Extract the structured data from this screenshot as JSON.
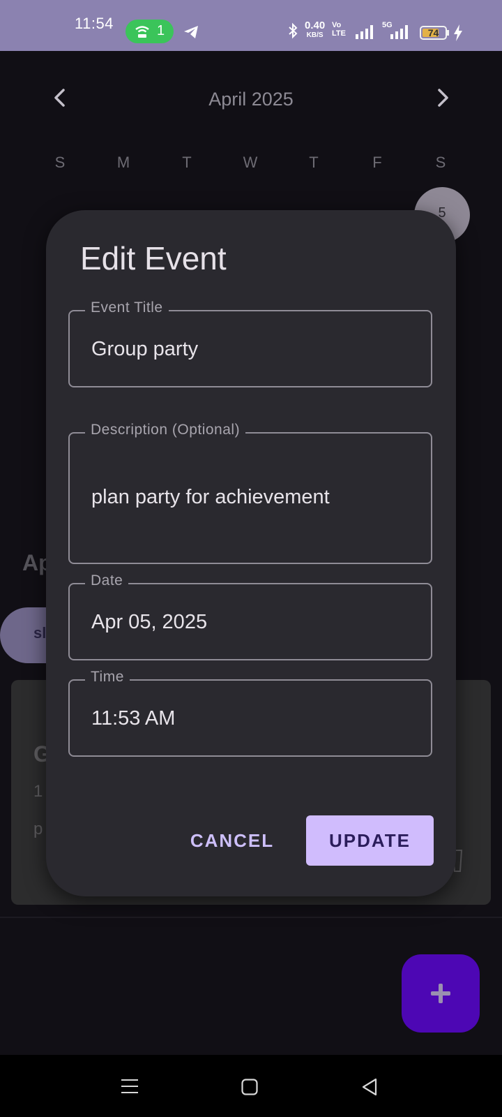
{
  "status_bar": {
    "time": "11:54",
    "hotspot_count": "1",
    "net_speed": "0.40",
    "net_speed_unit": "KB/S",
    "volte_label": "Vo LTE",
    "network_type": "5G",
    "battery": "74",
    "battery_level": 0.74
  },
  "calendar": {
    "month_title": "April 2025",
    "weekdays": [
      "S",
      "M",
      "T",
      "W",
      "T",
      "F",
      "S"
    ],
    "selected_day": "5"
  },
  "background": {
    "section_heading": "Ap",
    "chip_label": "sl",
    "card": {
      "title": "G",
      "time": "1",
      "description": "p"
    }
  },
  "dialog": {
    "title": "Edit Event",
    "fields": [
      {
        "label": "Event Title",
        "value": "Group party"
      },
      {
        "label": "Description (Optional)",
        "value": "plan party for achievement"
      },
      {
        "label": "Date",
        "value": "Apr 05, 2025"
      },
      {
        "label": "Time",
        "value": "11:53 AM"
      }
    ],
    "cancel_label": "CANCEL",
    "update_label": "UPDATE"
  },
  "icons": {
    "prev": "chevron-left-icon",
    "next": "chevron-right-icon",
    "fab": "plus-icon",
    "nav": [
      "menu-icon",
      "home-icon",
      "back-icon"
    ]
  },
  "colors": {
    "status_bar": "#8b82b0",
    "background": "#110f15",
    "dialog": "#2a292f",
    "accent": "#d0bcfd",
    "fab": "#4d07b4"
  }
}
